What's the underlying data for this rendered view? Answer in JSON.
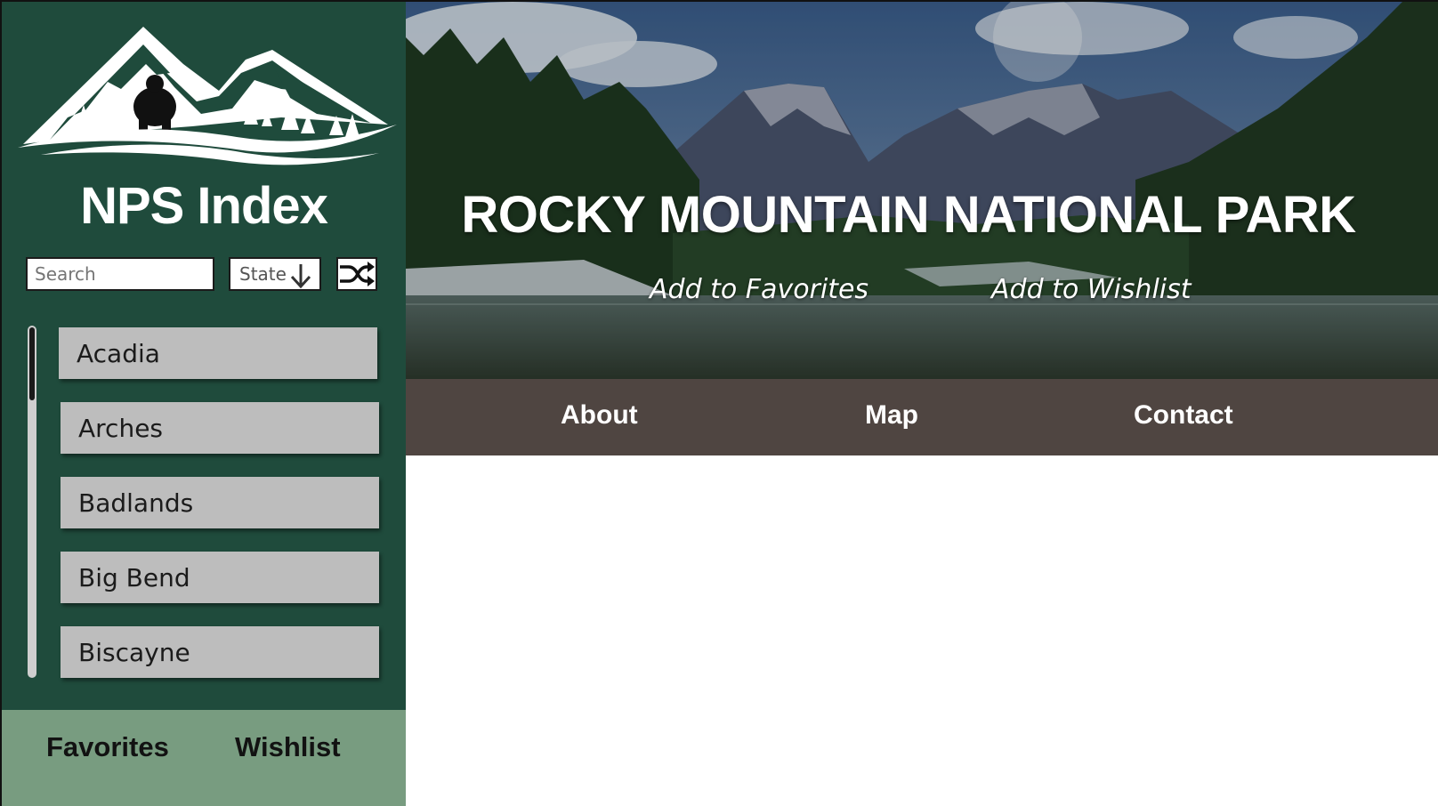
{
  "sidebar": {
    "title": "NPS Index",
    "search_placeholder": "Search",
    "state_label": "State",
    "parks": [
      "Acadia",
      "Arches",
      "Badlands",
      "Big Bend",
      "Biscayne"
    ],
    "favorites_label": "Favorites",
    "wishlist_label": "Wishlist"
  },
  "hero": {
    "title": "ROCKY MOUNTAIN NATIONAL PARK",
    "add_favorites": "Add to Favorites",
    "add_wishlist": "Add to Wishlist"
  },
  "nav": {
    "about": "About",
    "map": "Map",
    "contact": "Contact"
  },
  "colors": {
    "sidebar_bg": "#1f4b3c",
    "sidebar_footer_bg": "#789c80",
    "navbar_bg": "#4f4541",
    "list_item_bg": "#bdbdbd"
  },
  "icons": {
    "logo": "mountain-bear-logo",
    "state_sort": "arrow-down-icon",
    "shuffle": "shuffle-icon"
  }
}
